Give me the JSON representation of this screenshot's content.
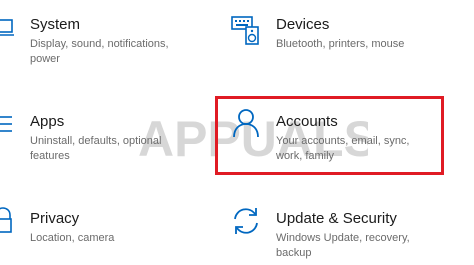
{
  "colors": {
    "accent": "#0067c0",
    "highlight": "#e01b24",
    "title": "#1b1b1b",
    "desc": "#6b6b6b"
  },
  "tiles": [
    {
      "title": "System",
      "desc": "Display, sound, notifications, power",
      "icon": "laptop-icon"
    },
    {
      "title": "Devices",
      "desc": "Bluetooth, printers, mouse",
      "icon": "keyboard-speaker-icon"
    },
    {
      "title": "Apps",
      "desc": "Uninstall, defaults, optional features",
      "icon": "list-icon"
    },
    {
      "title": "Accounts",
      "desc": "Your accounts, email, sync, work, family",
      "icon": "person-icon"
    },
    {
      "title": "Privacy",
      "desc": "Location, camera",
      "icon": "lock-icon"
    },
    {
      "title": "Update & Security",
      "desc": "Windows Update, recovery, backup",
      "icon": "sync-icon"
    }
  ],
  "watermark": {
    "text": "APPUALS"
  }
}
